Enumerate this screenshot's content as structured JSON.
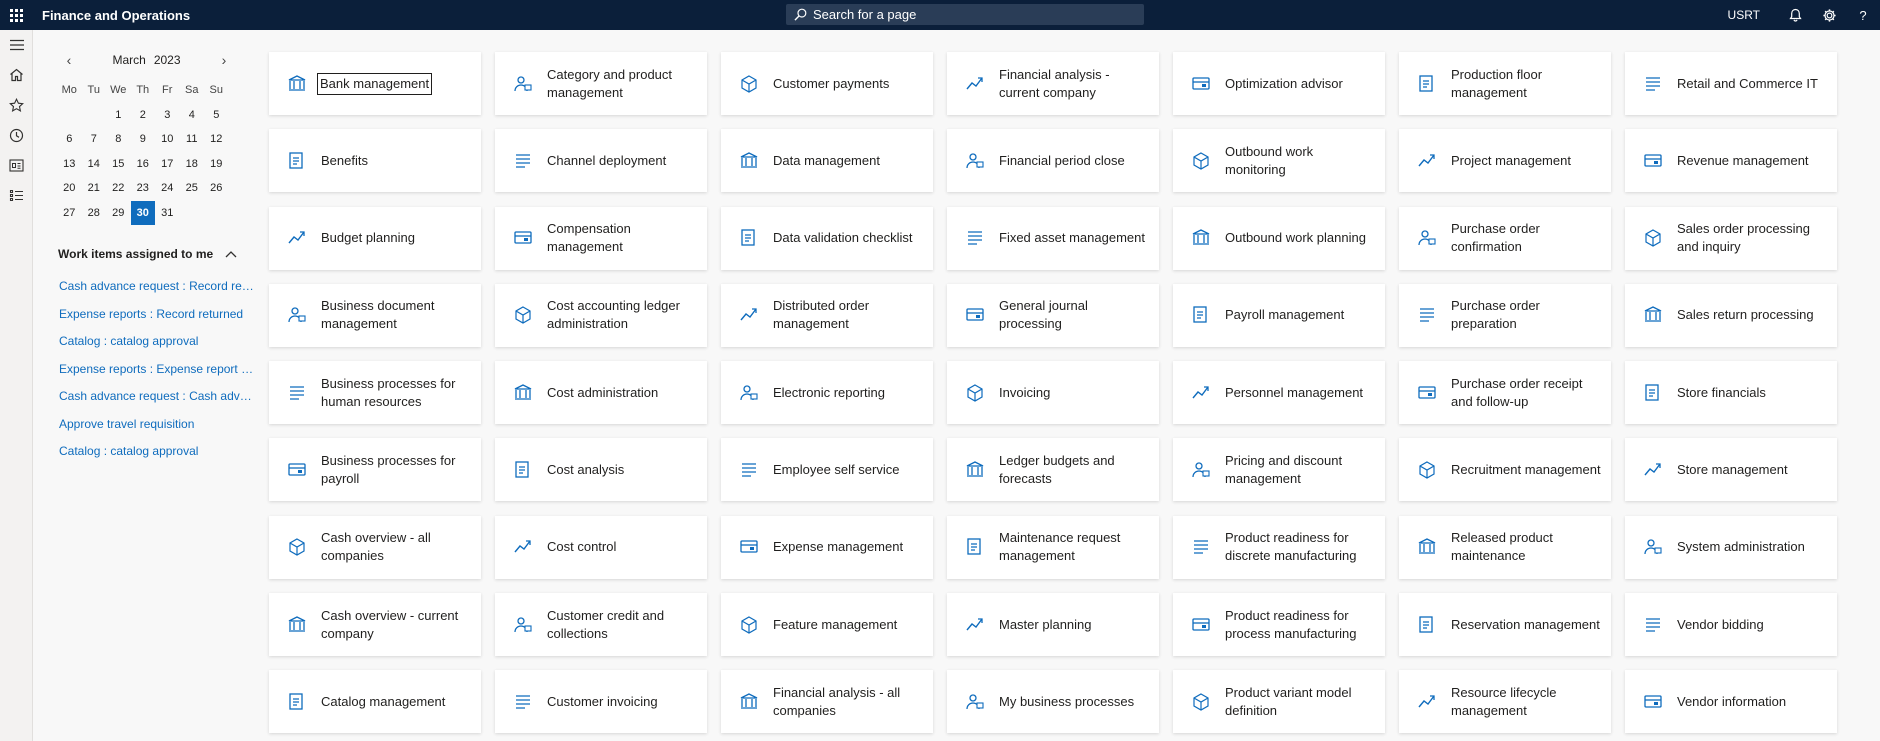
{
  "header": {
    "app_title": "Finance and Operations",
    "search_placeholder": "Search for a page",
    "user": "USRT",
    "help_label": "?"
  },
  "calendar": {
    "month": "March",
    "year": "2023",
    "weekdays": [
      "Mo",
      "Tu",
      "We",
      "Th",
      "Fr",
      "Sa",
      "Su"
    ],
    "weeks": [
      [
        "",
        "",
        "1",
        "2",
        "3",
        "4",
        "5"
      ],
      [
        "6",
        "7",
        "8",
        "9",
        "10",
        "11",
        "12"
      ],
      [
        "13",
        "14",
        "15",
        "16",
        "17",
        "18",
        "19"
      ],
      [
        "20",
        "21",
        "22",
        "23",
        "24",
        "25",
        "26"
      ],
      [
        "27",
        "28",
        "29",
        "30",
        "31",
        "",
        ""
      ]
    ],
    "selected": "30"
  },
  "work_items": {
    "heading": "Work items assigned to me",
    "items": [
      "Cash advance request : Record ret...",
      "Expense reports : Record returned",
      "Catalog : catalog approval",
      "Expense reports : Expense report a...",
      "Cash advance request : Cash advan...",
      "Approve travel requisition",
      "Catalog : catalog approval"
    ]
  },
  "tiles": [
    [
      "Bank management",
      "Benefits",
      "Budget planning",
      "Business document management",
      "Business processes for human resources",
      "Business processes for payroll",
      "Cash overview - all companies",
      "Cash overview - current company",
      "Catalog management"
    ],
    [
      "Category and product management",
      "Channel deployment",
      "Compensation management",
      "Cost accounting ledger administration",
      "Cost administration",
      "Cost analysis",
      "Cost control",
      "Customer credit and collections",
      "Customer invoicing"
    ],
    [
      "Customer payments",
      "Data management",
      "Data validation checklist",
      "Distributed order management",
      "Electronic reporting",
      "Employee self service",
      "Expense management",
      "Feature management",
      "Financial analysis - all companies"
    ],
    [
      "Financial analysis - current company",
      "Financial period close",
      "Fixed asset management",
      "General journal processing",
      "Invoicing",
      "Ledger budgets and forecasts",
      "Maintenance request management",
      "Master planning",
      "My business processes"
    ],
    [
      "Optimization advisor",
      "Outbound work monitoring",
      "Outbound work planning",
      "Payroll management",
      "Personnel management",
      "Pricing and discount management",
      "Product readiness for discrete manufacturing",
      "Product readiness for process manufacturing",
      "Product variant model definition"
    ],
    [
      "Production floor management",
      "Project management",
      "Purchase order confirmation",
      "Purchase order preparation",
      "Purchase order receipt and follow-up",
      "Recruitment management",
      "Released product maintenance",
      "Reservation management",
      "Resource lifecycle management"
    ],
    [
      "Retail and Commerce IT",
      "Revenue management",
      "Sales order processing and inquiry",
      "Sales return processing",
      "Store financials",
      "Store management",
      "System administration",
      "Vendor bidding",
      "Vendor information"
    ]
  ],
  "colors": {
    "topbar": "#0b1f3a",
    "accent": "#0f6cbd",
    "link": "#0f6cbd"
  }
}
